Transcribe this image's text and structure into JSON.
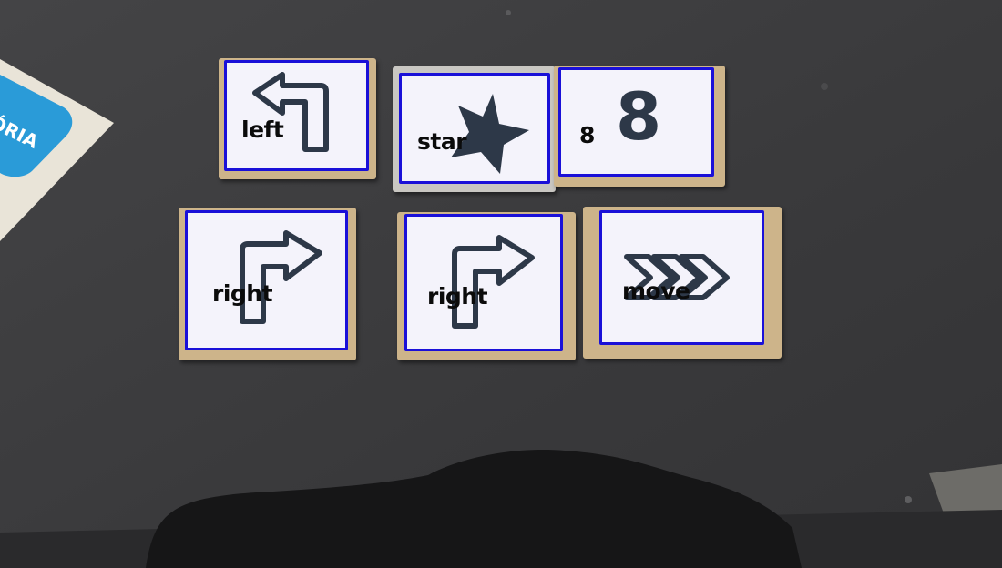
{
  "colors": {
    "table": "#3b3b3c",
    "tile_face": "#f4f3fb",
    "tile_border": "#1a10d8",
    "icon": "#2d3848",
    "label_text": "#0b0b0b"
  },
  "corner_card": {
    "text": "ÓRIA"
  },
  "tiles": [
    {
      "label": "left",
      "icon": "turn-left-arrow-icon"
    },
    {
      "label": "star",
      "icon": "star-icon"
    },
    {
      "label": "8",
      "number": "8",
      "icon": "number-8-glyph"
    },
    {
      "label": "right",
      "icon": "turn-right-arrow-icon"
    },
    {
      "label": "right",
      "icon": "turn-right-arrow-icon"
    },
    {
      "label": "move",
      "icon": "double-chevron-right-icon"
    }
  ]
}
